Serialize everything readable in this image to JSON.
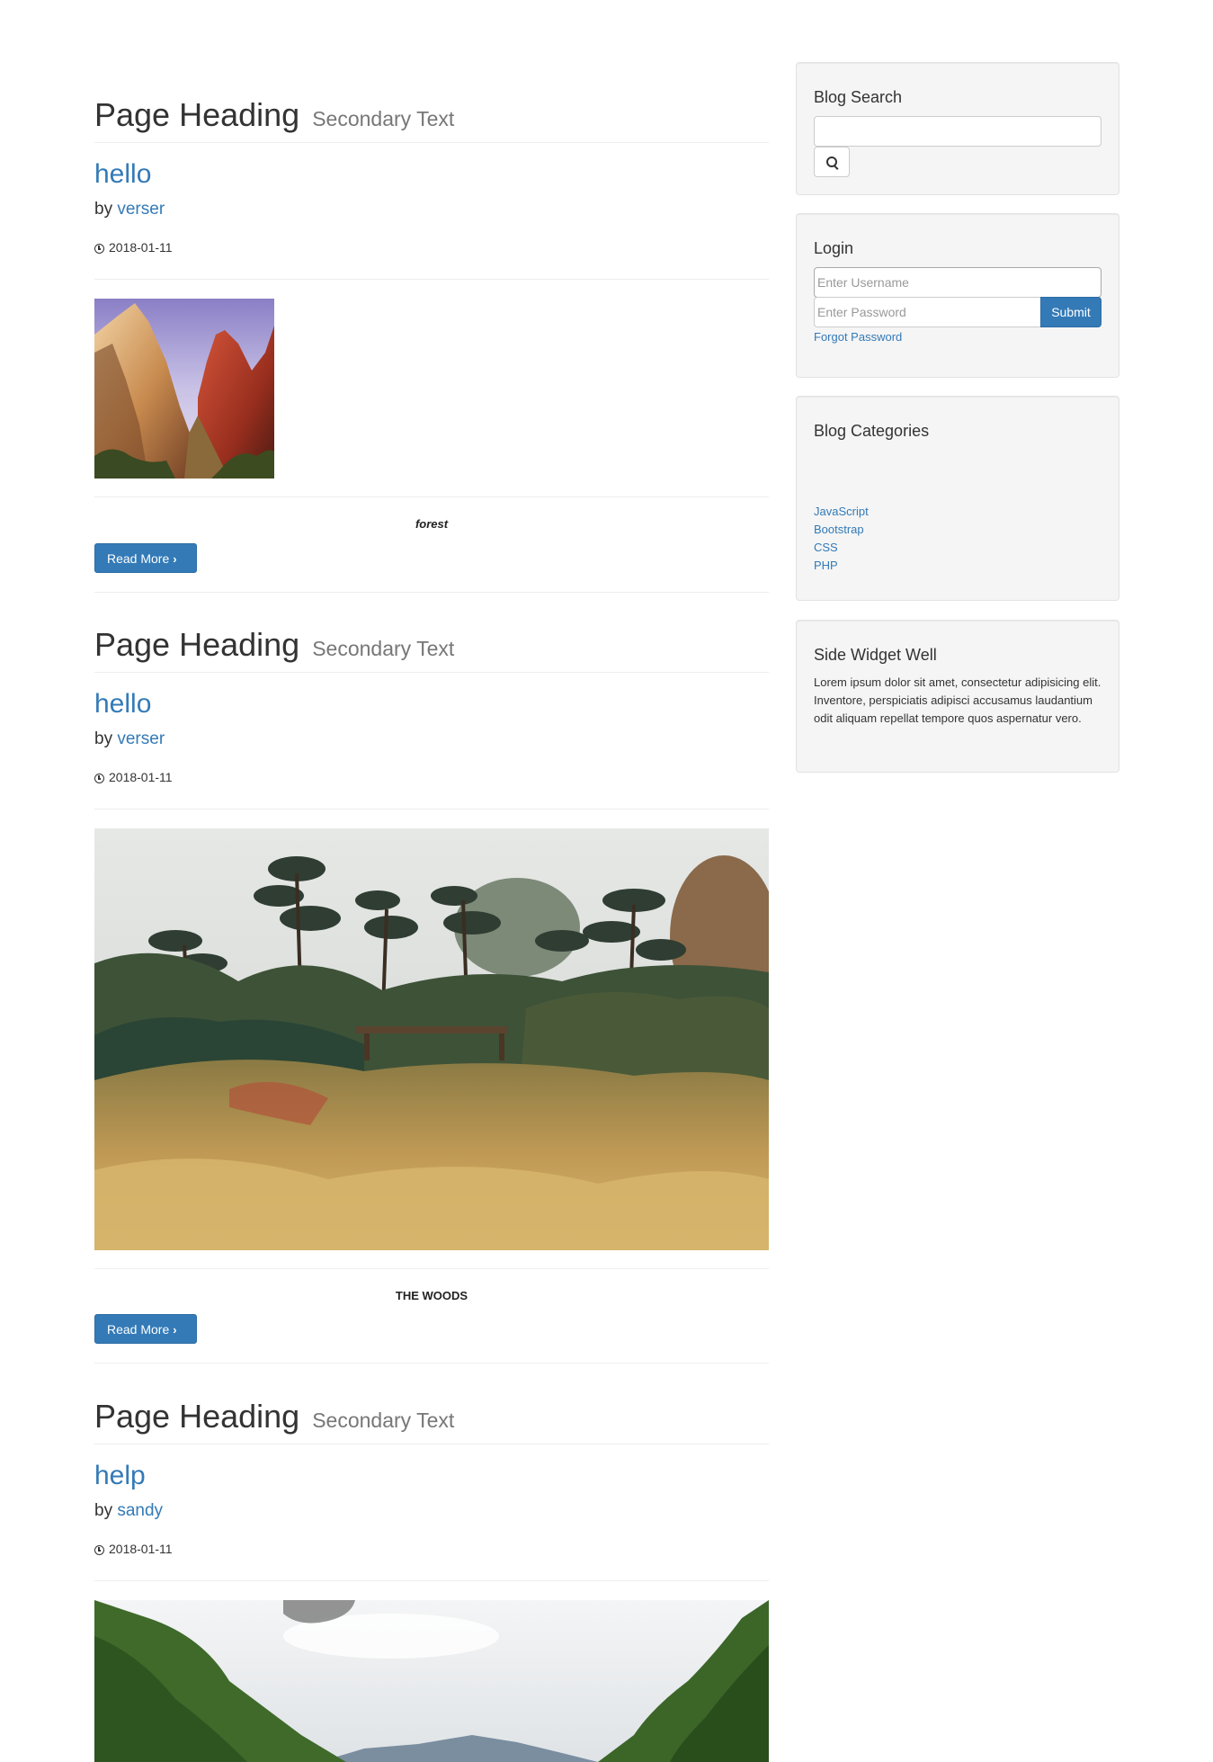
{
  "posts": [
    {
      "heading": "Page Heading",
      "secondary": "Secondary Text",
      "title": "hello",
      "by": "by",
      "author": "verser",
      "date": "2018-01-11",
      "caption": "forest",
      "read_more": "Read More"
    },
    {
      "heading": "Page Heading",
      "secondary": "Secondary Text",
      "title": "hello",
      "by": "by",
      "author": "verser",
      "date": "2018-01-11",
      "caption": "THE WOODS",
      "read_more": "Read More"
    },
    {
      "heading": "Page Heading",
      "secondary": "Secondary Text",
      "title": "help",
      "by": "by",
      "author": "sandy",
      "date": "2018-01-11"
    }
  ],
  "sidebar": {
    "search": {
      "title": "Blog Search",
      "value": "",
      "icon": "search-icon"
    },
    "login": {
      "title": "Login",
      "username_placeholder": "Enter Username",
      "password_placeholder": "Enter Password",
      "submit_label": "Submit",
      "forgot_label": "Forgot Password"
    },
    "categories": {
      "title": "Blog Categories",
      "items": [
        "JavaScript",
        "Bootstrap",
        "CSS",
        "PHP"
      ]
    },
    "widget": {
      "title": "Side Widget Well",
      "text": "Lorem ipsum dolor sit amet, consectetur adipisicing elit. Inventore, perspiciatis adipisci accusamus laudantium odit aliquam repellat tempore quos aspernatur vero."
    }
  },
  "colors": {
    "link": "#337ab7",
    "button": "#337ab7",
    "well_bg": "#f5f5f5",
    "rule": "#eeeeee"
  }
}
